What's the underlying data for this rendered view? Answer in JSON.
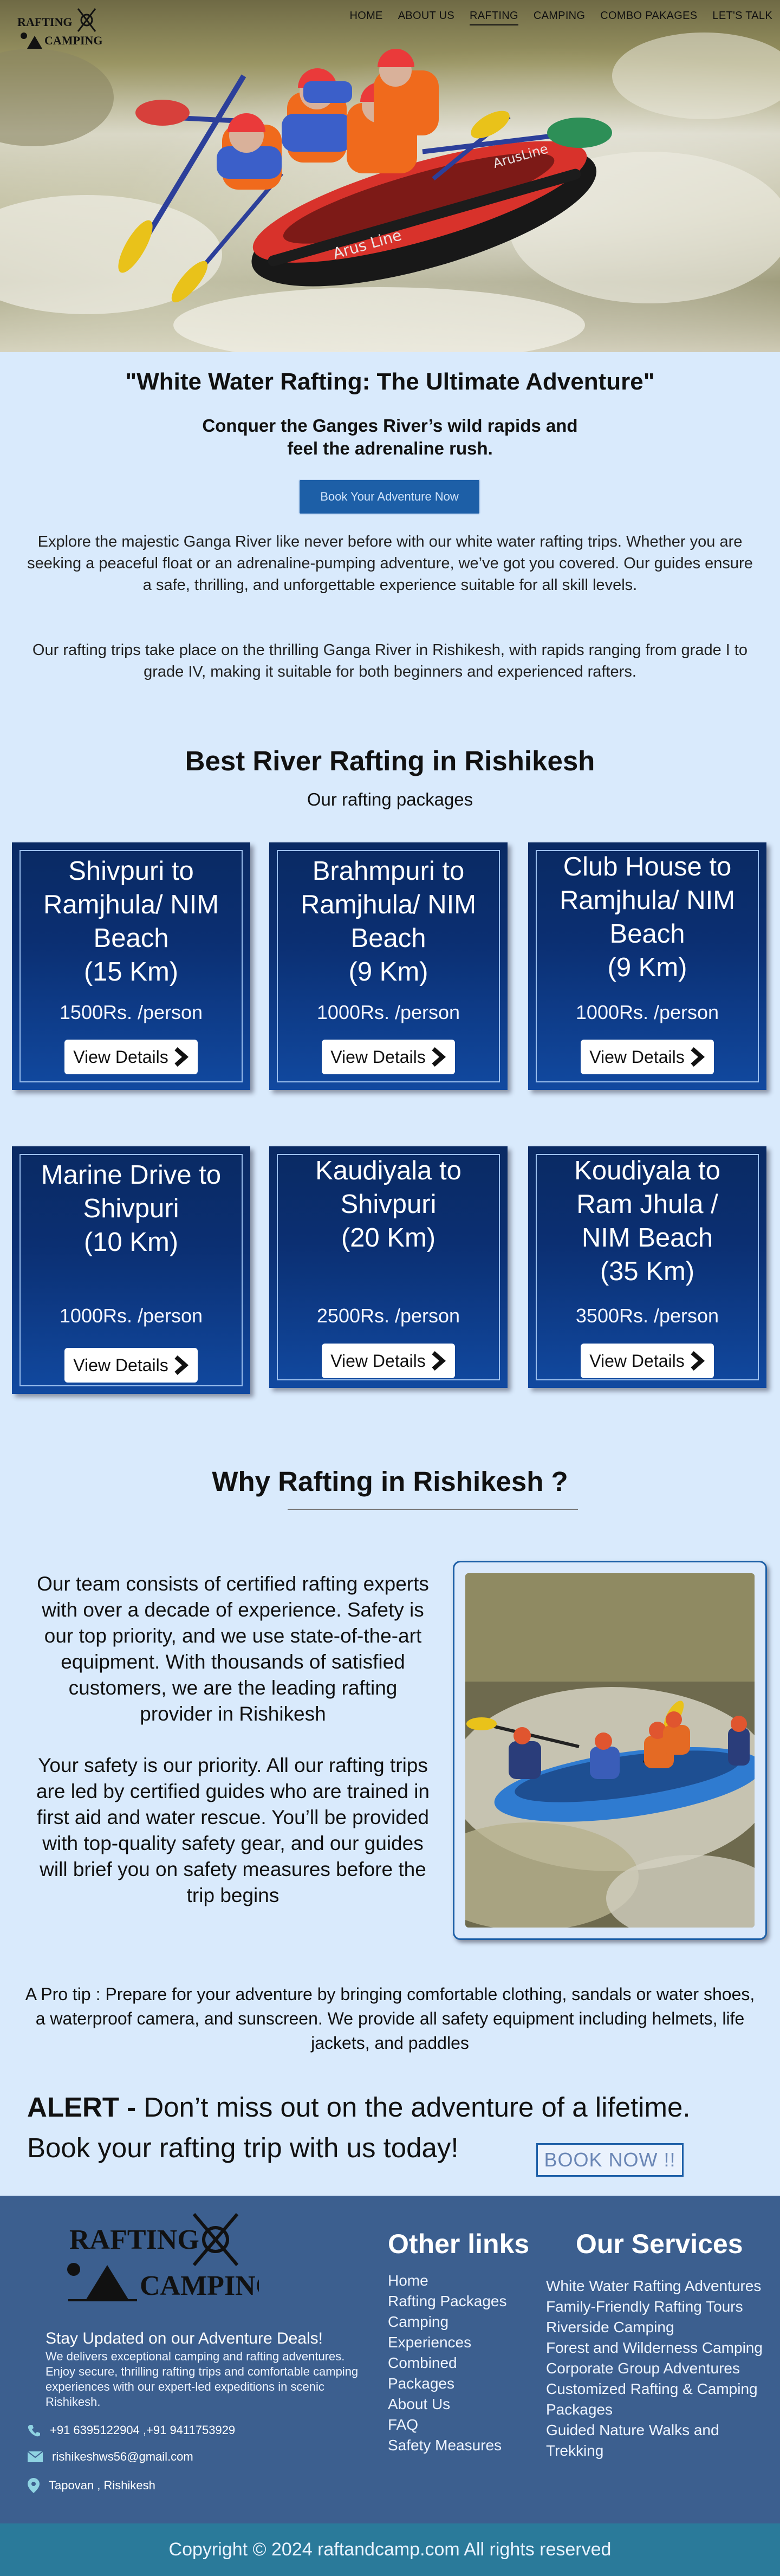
{
  "brand": {
    "line1": "RAFTING",
    "line2": "CAMPING"
  },
  "nav": {
    "items": [
      {
        "label": "HOME"
      },
      {
        "label": "ABOUT US"
      },
      {
        "label": "RAFTING"
      },
      {
        "label": "CAMPING"
      },
      {
        "label": "COMBO PAKAGES"
      },
      {
        "label": "LET'S TALK"
      }
    ],
    "active": "RAFTING"
  },
  "hero": {
    "boat_text_1": "ArusLine",
    "boat_text_2": "Arus Line"
  },
  "intro": {
    "title": "\"White Water Rafting: The Ultimate Adventure\"",
    "subtitle": "Conquer the Ganges River’s wild rapids and feel the adrenaline rush.",
    "button": "Book Your Adventure Now",
    "para1": "Explore the majestic Ganga River like never before with our white water rafting trips. Whether you are seeking a peaceful float or an adrenaline-pumping adventure, we’ve got you covered. Our guides ensure a safe, thrilling, and unforgettable experience suitable for all skill levels.",
    "para2": "Our rafting trips take place on the thrilling Ganga River in Rishikesh, with rapids ranging from grade I to grade IV, making it suitable for both beginners and experienced rafters."
  },
  "packages": {
    "title": "Best River Rafting in Rishikesh",
    "subtitle": "Our rafting packages",
    "button_label": "View Details",
    "items": [
      {
        "name": "Shivpuri to Ramjhula/ NIM Beach",
        "distance": "(15 Km)",
        "price": "1500Rs. /person"
      },
      {
        "name": "Brahmpuri to Ramjhula/ NIM Beach",
        "distance": "(9 Km)",
        "price": "1000Rs. /person"
      },
      {
        "name": "Club House to Ramjhula/ NIM Beach",
        "distance": "(9 Km)",
        "price": "1000Rs. /person"
      },
      {
        "name": "Marine Drive to Shivpuri",
        "distance": "(10 Km)",
        "price": "1000Rs. /person"
      },
      {
        "name": "Kaudiyala to Shivpuri",
        "distance": "(20 Km)",
        "price": "2500Rs. /person"
      },
      {
        "name": "Koudiyala to Ram Jhula / NIM Beach",
        "distance": "(35 Km)",
        "price": "3500Rs. /person"
      }
    ]
  },
  "why": {
    "title": "Why Rafting in Rishikesh ?",
    "para1": "Our team consists of certified rafting experts with over a decade of experience. Safety is our top priority, and we use state-of-the-art equipment. With thousands of satisfied customers, we are the leading rafting provider in Rishikesh",
    "para2": "Your safety is our priority. All our rafting trips are led by certified guides who are trained in first aid and water rescue. You’ll be provided with top-quality safety gear, and our guides will brief you on safety measures before the trip begins"
  },
  "tip": {
    "label": "A Pro tip",
    "text": ": Prepare for your adventure by bringing comfortable clothing, sandals or water shoes, a waterproof camera, and sunscreen. We provide all safety equipment including helmets, life jackets, and paddles"
  },
  "alert": {
    "label": "ALERT -",
    "line1": "Don’t miss out on the adventure of a lifetime.",
    "line2": "Book your rafting trip with us today!",
    "button": "BOOK NOW !!"
  },
  "footer": {
    "heading": "Stay Updated on our Adventure Deals!",
    "description": "We delivers exceptional camping and rafting adventures. Enjoy secure, thrilling rafting trips and comfortable camping experiences with our expert-led expeditions in scenic Rishikesh.",
    "phone": "+91 6395122904 ,+91 9411753929",
    "email": "rishikeshws56@gmail.com",
    "address": "Tapovan , Rishikesh",
    "links_title": "Other links",
    "links": [
      "Home",
      "Rafting Packages",
      "Camping",
      "Experiences",
      "Combined",
      "Packages",
      "About Us",
      "FAQ",
      "Safety Measures"
    ],
    "services_title": "Our Services",
    "services": [
      "White Water Rafting Adventures",
      "Family-Friendly Rafting Tours",
      "Riverside Camping",
      "Forest and Wilderness Camping",
      "Corporate Group Adventures",
      "Customized Rafting & Camping",
      "Packages",
      "Guided Nature Walks and",
      "Trekking"
    ],
    "copyright": "Copyright © 2024 raftandcamp.com All rights reserved"
  },
  "colors": {
    "page_bg": "#d9eafc",
    "accent": "#1d5fa7",
    "card_dark": "#0a2a63",
    "footer_bg": "#3c5f8f",
    "copyright_bg": "#2a7a9a"
  }
}
